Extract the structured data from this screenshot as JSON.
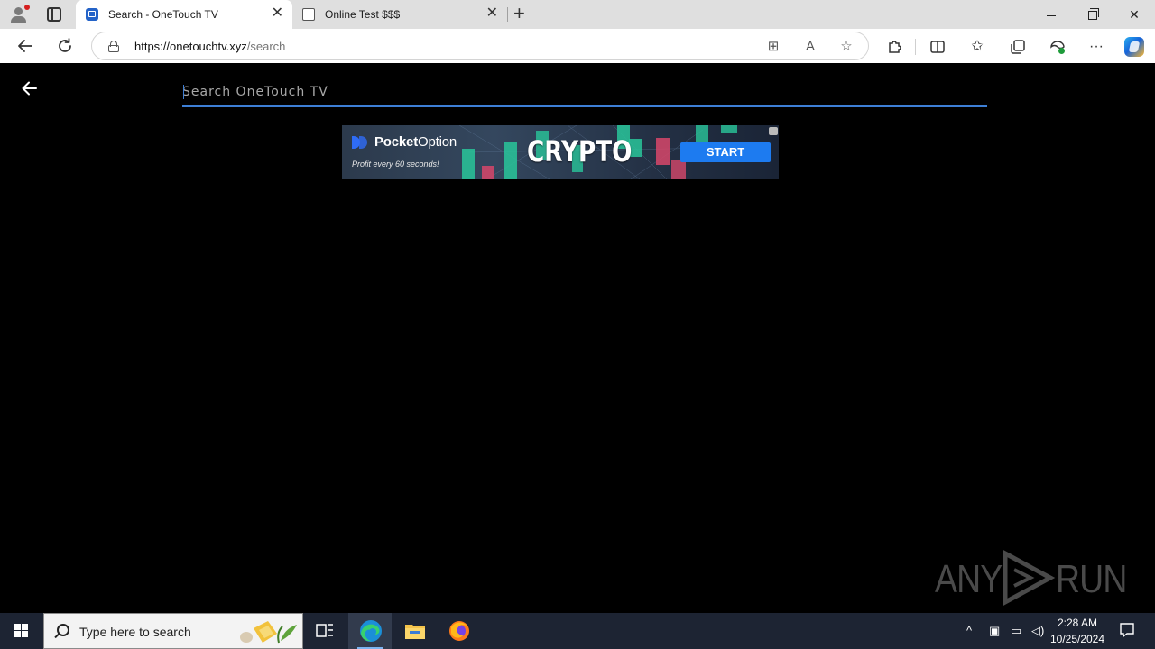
{
  "browser": {
    "tabs": [
      {
        "title": "Search - OneTouch TV",
        "active": true
      },
      {
        "title": "Online Test $$$",
        "active": false
      }
    ],
    "new_tab_label": "+",
    "url_host": "https://onetouchtv.xyz",
    "url_path": "/search"
  },
  "page": {
    "search_placeholder": "Search OneTouch TV",
    "accent_color": "#3d7fd6"
  },
  "ad": {
    "brand_bold": "Pocket",
    "brand_light": "Option",
    "tagline": "Profit every 60 seconds!",
    "headline": "CRYPTO",
    "cta": "START"
  },
  "watermark": {
    "left": "ANY",
    "right": "RUN"
  },
  "taskbar": {
    "search_placeholder": "Type here to search",
    "time": "2:28 AM",
    "date": "10/25/2024"
  }
}
